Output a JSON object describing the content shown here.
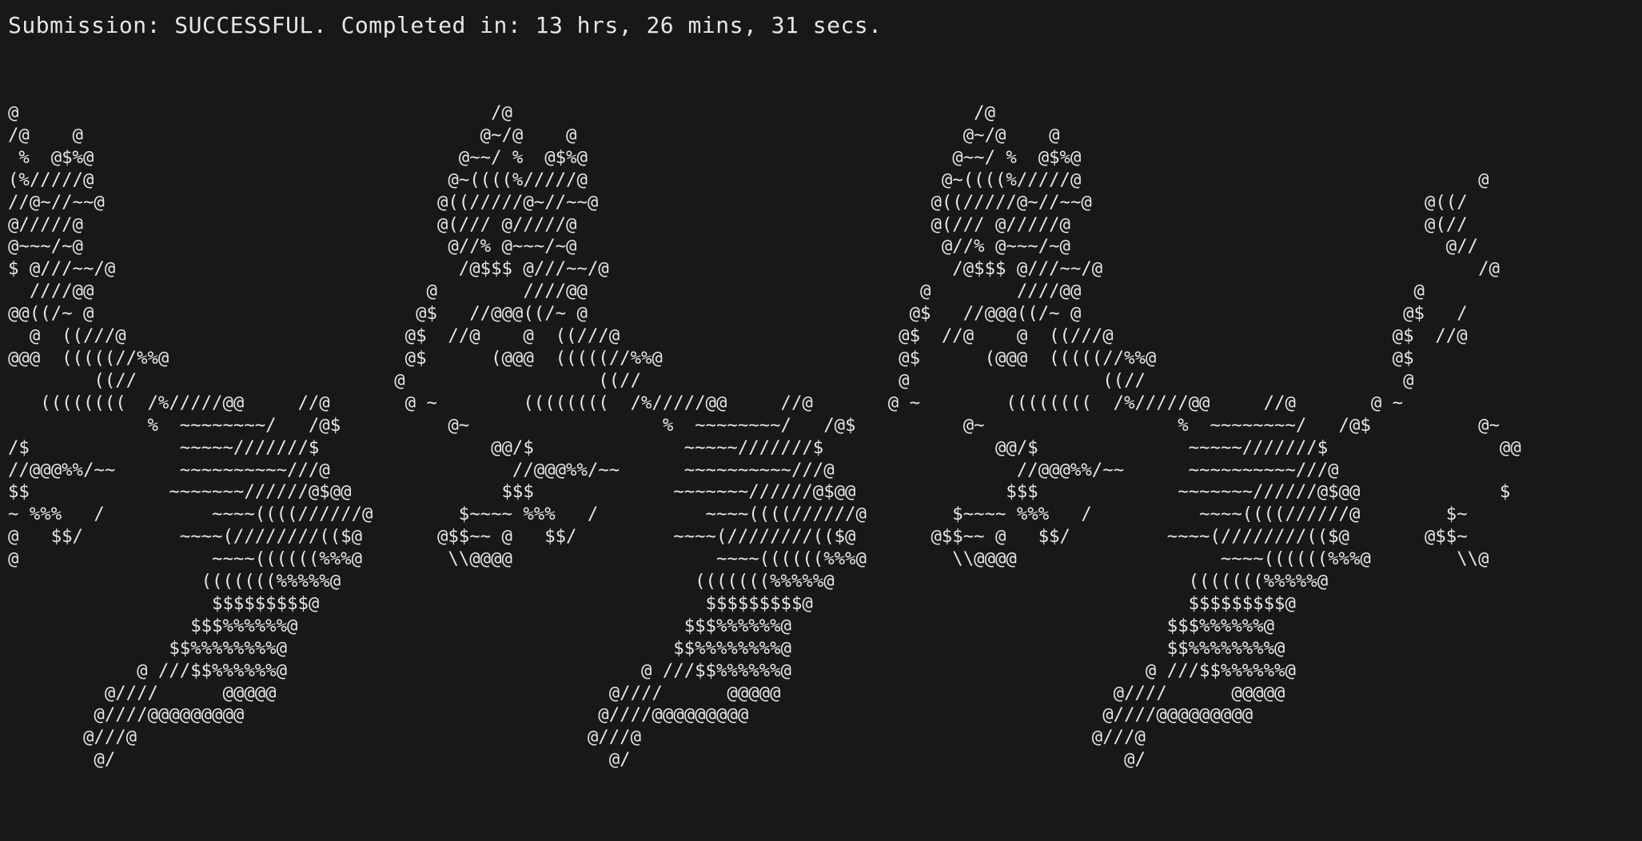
{
  "terminal": {
    "status_line": "Submission: SUCCESSFUL. Completed in: 13 hrs, 26 mins, 31 secs.",
    "ascii_art": "@                                            /@                                           /@\n/@    @                                     @~/@    @                                    @~/@    @\n %  @$%@                                  @~~/ %  @$%@                                  @~~/ %  @$%@\n(%/////@                                 @~((((%/////@                                 @~((((%/////@                                     @\n//@~//~~@                               @((/////@~//~~@                               @((/////@~//~~@                               @((/\n@/////@                                 @(/// @/////@                                 @(/// @/////@                                 @(//\n@~~~/~@                                  @//% @~~~/~@                                  @//% @~~~/~@                                   @//\n$ @///~~/@                                /@$$$ @///~~/@                                /@$$$ @///~~/@                                   /@\n  ////@@                               @        ////@@                               @        ////@@                               @\n@@((/~ @                              @$   //@@@((/~ @                              @$   //@@@((/~ @                              @$   /\n  @  ((///@                          @$  //@    @  ((///@                          @$  //@    @  ((///@                          @$  //@\n@@@  (((((//%%@                      @$      (@@@  (((((//%%@                      @$      (@@@  (((((//%%@                      @$\n        ((//                        @                  ((//                        @                  ((//                        @\n   ((((((((  /%/////@@     //@       @ ~        ((((((((  /%/////@@     //@       @ ~        ((((((((  /%/////@@     //@       @ ~\n             %  ~~~~~~~~/   /@$          @~                  %  ~~~~~~~~/   /@$          @~                  %  ~~~~~~~~/   /@$          @~\n/$              ~~~~~///////$                @@/$              ~~~~~///////$                @@/$              ~~~~~///////$                @@\n//@@@%%/~~      ~~~~~~~~~~///@                 //@@@%%/~~      ~~~~~~~~~~///@                 //@@@%%/~~      ~~~~~~~~~~///@\n$$             ~~~~~~~//////@$@@              $$$             ~~~~~~~//////@$@@              $$$             ~~~~~~~//////@$@@             $\n~ %%%   /          ~~~~((((//////@        $~~~~ %%%   /          ~~~~((((//////@        $~~~~ %%%   /          ~~~~((((//////@        $~\n@   $$/         ~~~~(////////(($@       @$$~~ @   $$/         ~~~~(////////(($@       @$$~~ @   $$/         ~~~~(////////(($@       @$$~\n@                  ~~~~((((((%%%@        \\\\@@@@                   ~~~~((((((%%%@        \\\\@@@@                   ~~~~((((((%%%@        \\\\@\n                  (((((((%%%%%@                                 (((((((%%%%%@                                 (((((((%%%%%@\n                   $$$$$$$$$@                                    $$$$$$$$$@                                   $$$$$$$$$@\n                 $$$%%%%%%@                                    $$$%%%%%%@                                   $$$%%%%%%@\n               $$%%%%%%%%@                                    $$%%%%%%%%@                                   $$%%%%%%%%@\n            @ ///$$%%%%%%@                                 @ ///$$%%%%%%@                                 @ ///$$%%%%%%@\n         @////      @@@@@                               @////      @@@@@                               @////      @@@@@\n        @////@@@@@@@@@                                 @////@@@@@@@@@                                 @////@@@@@@@@@\n       @///@                                          @///@                                          @///@\n        @/                                              @/                                              @/"
  }
}
